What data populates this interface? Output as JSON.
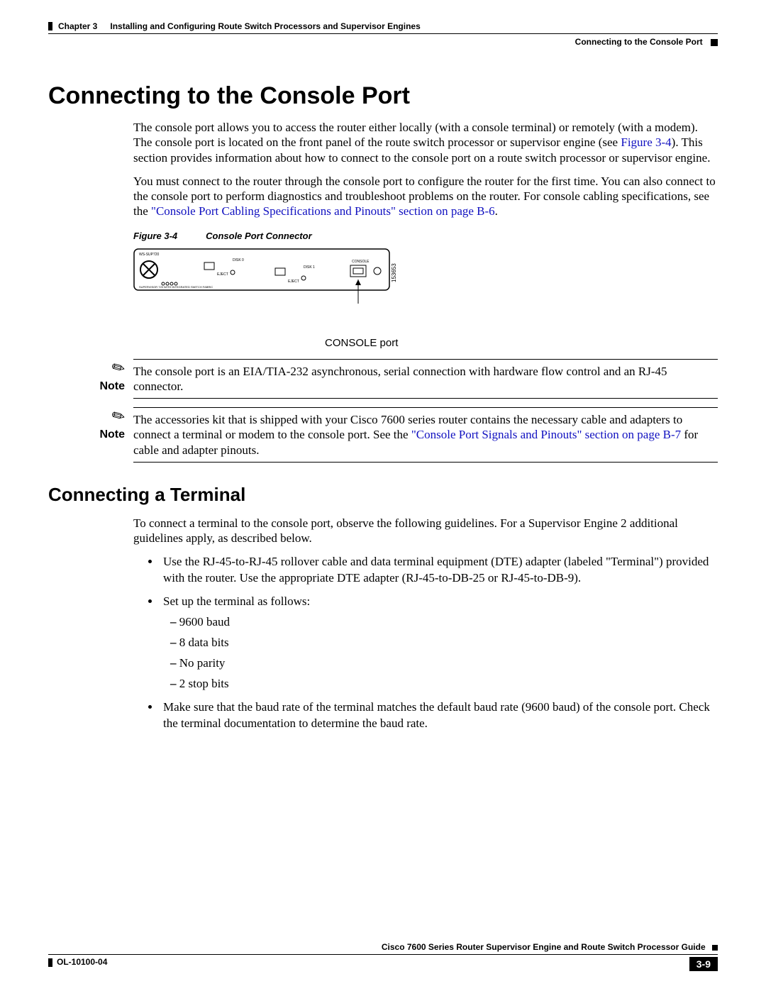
{
  "header": {
    "chapter": "Chapter 3",
    "title": "Installing and Configuring Route Switch Processors and Supervisor Engines",
    "section": "Connecting to the Console Port"
  },
  "h1": "Connecting to the Console Port",
  "p1_a": "The console port allows you to access the router either locally (with a console terminal) or remotely (with a modem). The console port is located on the front panel of the route switch processor or supervisor engine (see ",
  "p1_link": "Figure 3-4",
  "p1_b": "). This section provides information about how to connect to the console port on a route switch processor or supervisor engine.",
  "p2_a": "You must connect to the router through the console port to configure the router for the first time. You can also connect to the console port to perform diagnostics and troubleshoot problems on the router. For console cabling specifications, see the ",
  "p2_link": "\"Console Port Cabling Specifications and Pinouts\" section on page B-6",
  "p2_b": ".",
  "figure": {
    "num": "Figure 3-4",
    "title": "Console Port Connector",
    "label": "CONSOLE port",
    "panel": {
      "model": "WS-SUP720",
      "sub": "SUPERVISOR 720 WITH INTEGRATED SWITCH FABRIC",
      "disk0": "DISK 0",
      "disk1": "DISK 1",
      "eject": "EJECT",
      "console": "CONSOLE",
      "id": "153653"
    }
  },
  "note_label": "Note",
  "note1": "The console port is an EIA/TIA-232 asynchronous, serial connection with hardware flow control and an RJ-45 connector.",
  "note2_a": "The accessories kit that is shipped with your Cisco 7600 series router contains the necessary cable and adapters to connect a terminal or modem to the console port. See the ",
  "note2_link": "\"Console Port Signals and Pinouts\" section on page B-7",
  "note2_b": " for cable and adapter pinouts.",
  "h2": "Connecting a Terminal",
  "p3": "To connect a terminal to the console port, observe the following guidelines. For a Supervisor Engine 2 additional guidelines apply, as described below.",
  "bullets": {
    "b1": "Use the RJ-45-to-RJ-45 rollover cable and data terminal equipment (DTE) adapter (labeled \"Terminal\") provided with the router. Use the appropriate DTE adapter (RJ-45-to-DB-25 or RJ-45-to-DB-9).",
    "b2": "Set up the terminal as follows:",
    "b2_sub": {
      "s1": "9600 baud",
      "s2": "8 data bits",
      "s3": "No parity",
      "s4": "2 stop bits"
    },
    "b3": "Make sure that the baud rate of the terminal matches the default baud rate (9600 baud) of the console port. Check the terminal documentation to determine the baud rate."
  },
  "footer": {
    "book": "Cisco 7600 Series Router Supervisor Engine and Route Switch Processor Guide",
    "doc": "OL-10100-04",
    "page": "3-9"
  }
}
